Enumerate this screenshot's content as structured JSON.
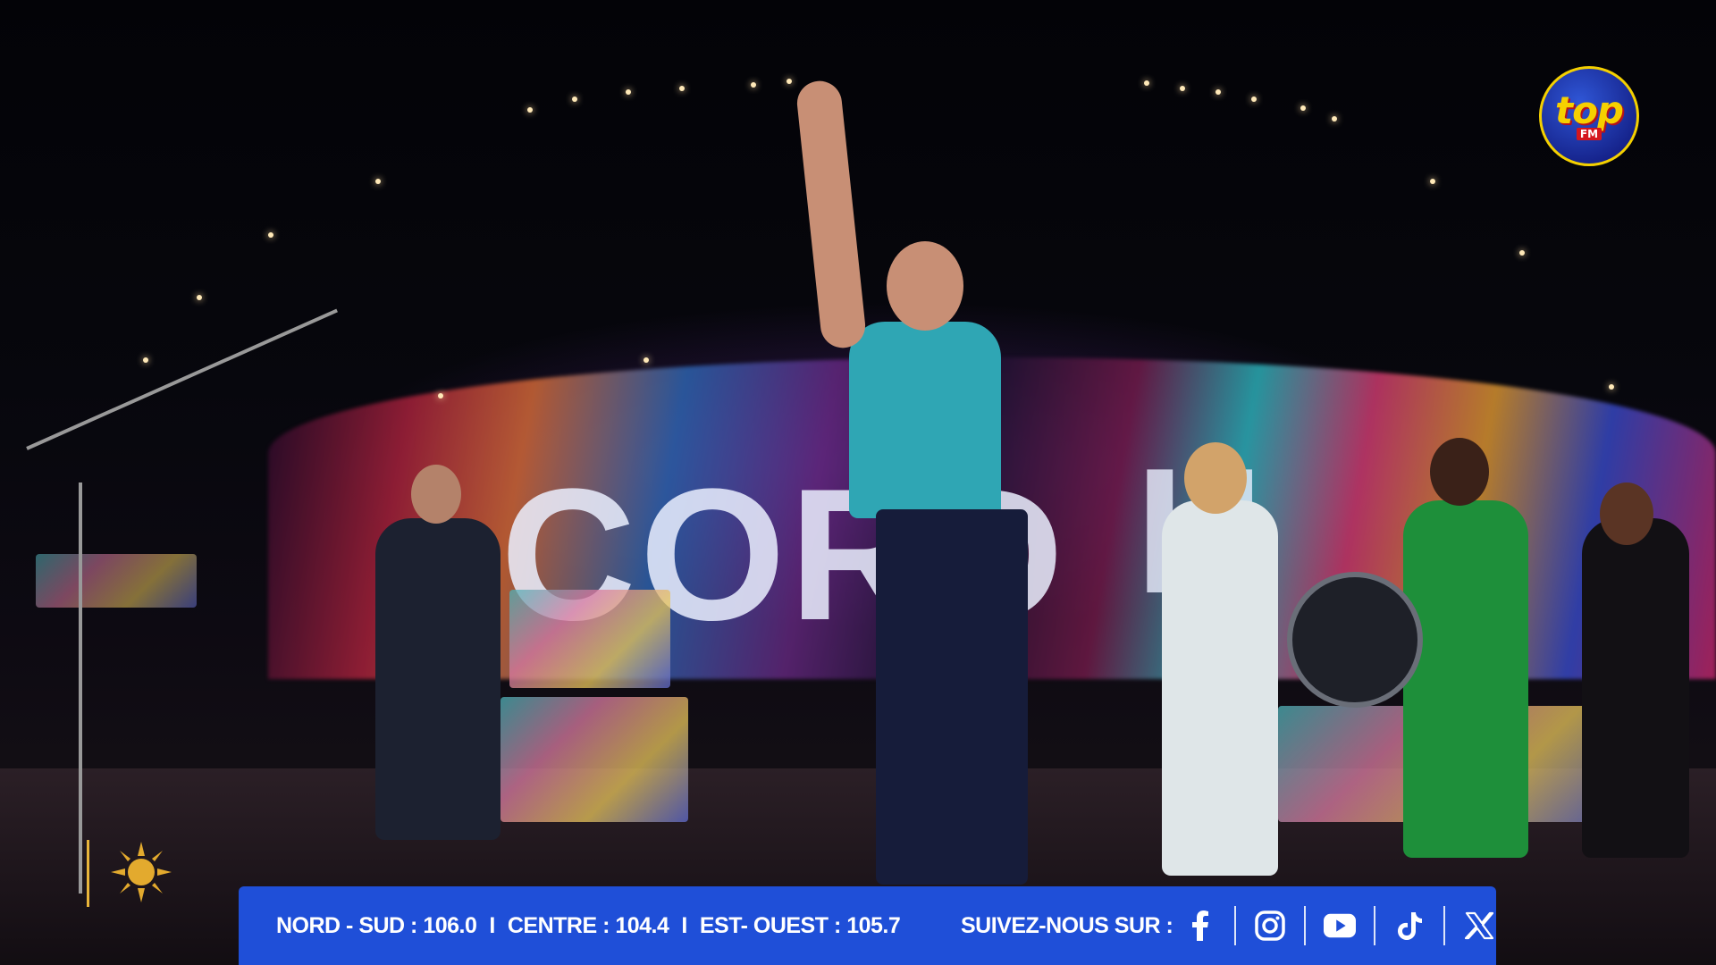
{
  "banner": {
    "frequencies": [
      {
        "label": "NORD - SUD : 106.0"
      },
      {
        "label": "CENTRE : 104.4"
      },
      {
        "label": "EST- OUEST : 105.7"
      }
    ],
    "separator": "I",
    "follow_label": "SUIVEZ-NOUS SUR :",
    "social": [
      "facebook-icon",
      "instagram-icon",
      "youtube-icon",
      "tiktok-icon",
      "x-icon"
    ],
    "background_color": "#1f4fd8"
  },
  "logo": {
    "top": "top",
    "fm": "FM"
  },
  "stage_screen": {
    "text_left": "CORD",
    "text_right": "H"
  },
  "colors": {
    "logo_yellow": "#f6d000",
    "logo_red": "#d4161e",
    "accent_gold": "#e9b53a"
  }
}
